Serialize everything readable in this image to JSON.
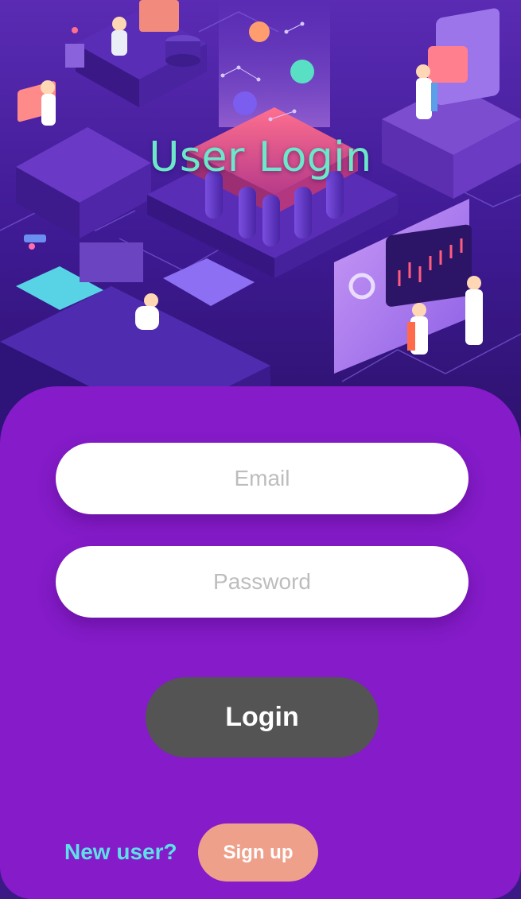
{
  "header": {
    "title": "User Login"
  },
  "form": {
    "email_placeholder": "Email",
    "password_placeholder": "Password",
    "login_label": "Login"
  },
  "footer": {
    "new_user_text": "New user?",
    "signup_label": "Sign up"
  },
  "colors": {
    "title": "#6be8c8",
    "card_background": "#851bc9",
    "login_button": "#545454",
    "signup_button": "#efa08a",
    "new_user_text": "#5ee0e6"
  }
}
